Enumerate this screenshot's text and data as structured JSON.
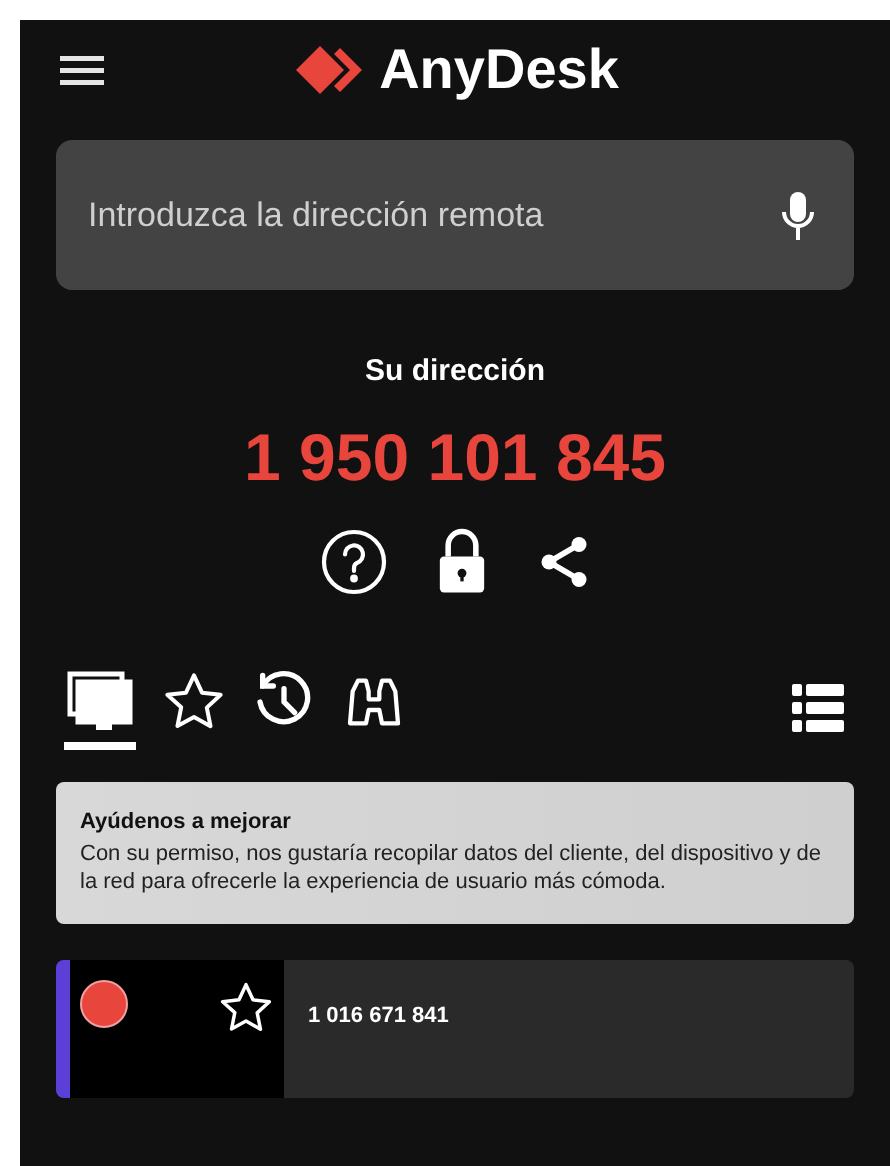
{
  "app": {
    "name": "AnyDesk"
  },
  "search": {
    "placeholder": "Introduzca la dirección remota"
  },
  "address": {
    "label": "Su dirección",
    "value": "1 950 101 845"
  },
  "tabs": [
    {
      "kind": "devices",
      "selected": true
    },
    {
      "kind": "favorites",
      "selected": false
    },
    {
      "kind": "history",
      "selected": false
    },
    {
      "kind": "discovery",
      "selected": false
    }
  ],
  "banner": {
    "title": "Ayúdenos a mejorar",
    "text": "Con su permiso, nos gustaría recopilar datos del cliente, del dispositivo y de la red para ofrecerle la experiencia de usuario más cómoda."
  },
  "sessions": [
    {
      "address": "1 016 671 841",
      "color": "#e8453c",
      "favorite": false
    }
  ]
}
